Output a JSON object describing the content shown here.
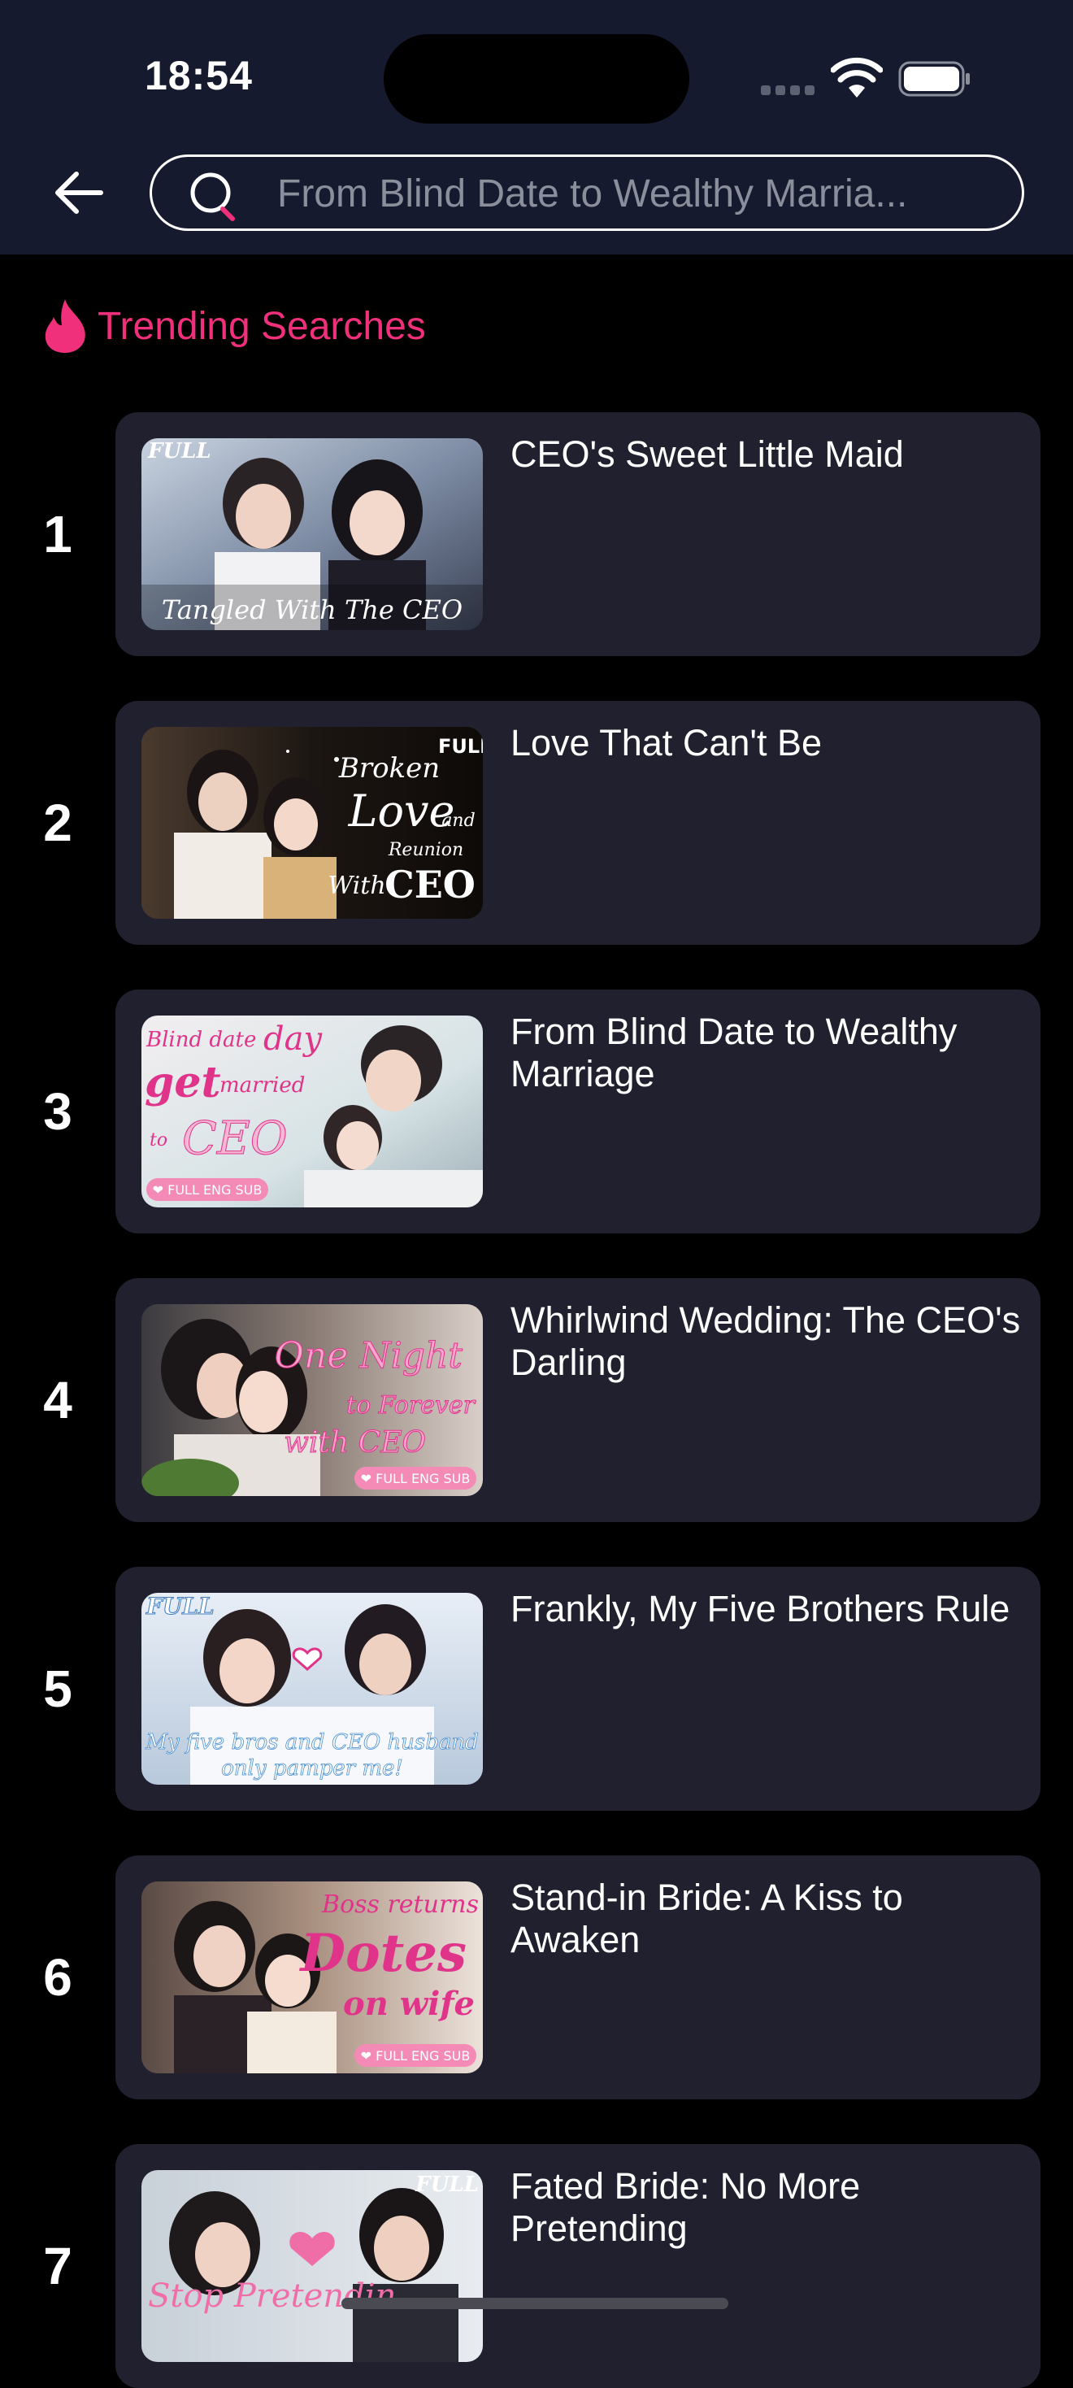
{
  "status_bar": {
    "time": "18:54"
  },
  "search": {
    "placeholder": "From Blind Date to Wealthy Marria..."
  },
  "trending": {
    "title": "Trending Searches",
    "accent_color": "#f0307a",
    "items": [
      {
        "rank": "1",
        "title": "CEO's Sweet Little Maid",
        "thumb_text": "Tangled With The CEO",
        "badge": "FULL"
      },
      {
        "rank": "2",
        "title": "Love That Can't Be",
        "thumb_text": "Broken Love and Reunion With CEO",
        "badge": "FULL"
      },
      {
        "rank": "3",
        "title": "From Blind Date to Wealthy Marriage",
        "thumb_text": "Blind date day get married to CEO",
        "badge": "FULL ENG SUB"
      },
      {
        "rank": "4",
        "title": "Whirlwind Wedding: The CEO's Darling",
        "thumb_text": "One Night to Forever with CEO",
        "badge": "FULL ENG SUB"
      },
      {
        "rank": "5",
        "title": "Frankly, My Five Brothers Rule",
        "thumb_text": "My five bros and CEO husband only pamper me!",
        "badge": "FULL"
      },
      {
        "rank": "6",
        "title": "Stand-in Bride: A Kiss to Awaken",
        "thumb_text": "Boss returns Dotes on wife",
        "badge": "FULL ENG SUB"
      },
      {
        "rank": "7",
        "title": "Fated Bride: No More Pretending",
        "thumb_text": "Stop Pretendin",
        "badge": "FULL"
      }
    ]
  }
}
